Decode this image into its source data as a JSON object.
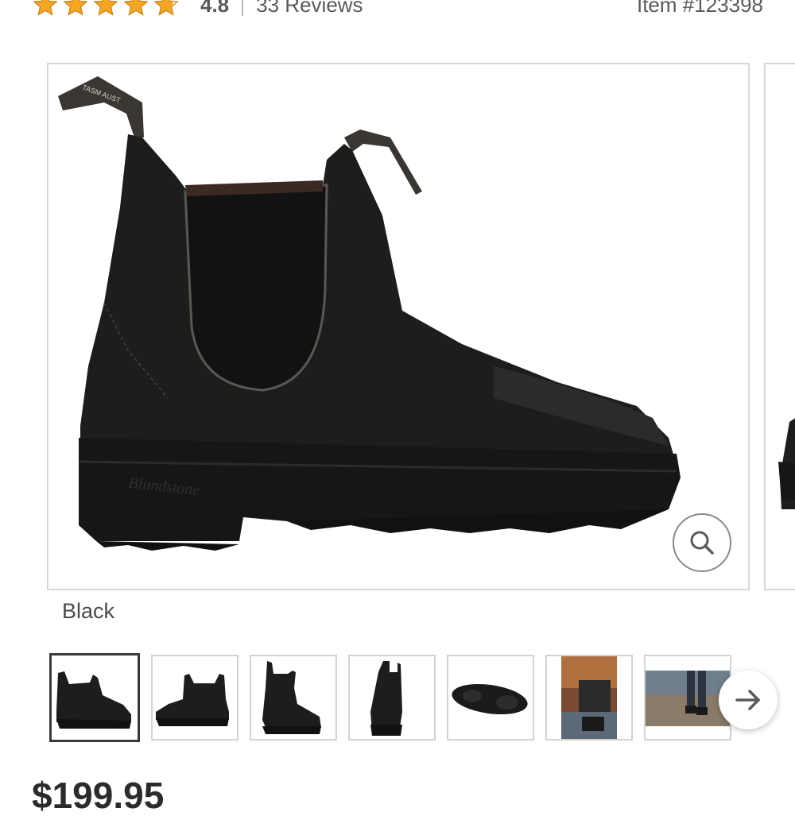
{
  "header": {
    "rating_value": "4.8",
    "reviews_label": "33 Reviews",
    "item_number": "Item #123398",
    "star_count": 4.8,
    "star_color": "#f5a623"
  },
  "gallery": {
    "selected_color": "Black",
    "zoom_icon": "magnifier-icon",
    "next_icon": "arrow-right-icon",
    "thumbnails": [
      {
        "alt": "side view",
        "active": true
      },
      {
        "alt": "side view alt"
      },
      {
        "alt": "three-quarter view"
      },
      {
        "alt": "back view"
      },
      {
        "alt": "sole view"
      },
      {
        "alt": "lifestyle photo 1"
      },
      {
        "alt": "lifestyle photo 2"
      }
    ]
  },
  "price": {
    "amount": "$199.95"
  },
  "colors": {
    "border": "#d9d7d3",
    "text": "#2b2b2b",
    "star": "#f5a623"
  }
}
